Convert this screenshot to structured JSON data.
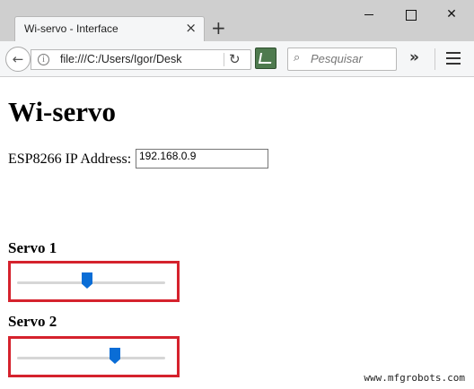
{
  "browser": {
    "tab_title": "Wi-servo - Interface",
    "tab_close_glyph": "×",
    "new_tab_glyph": "+",
    "url": "file:///C:/Users/Igor/Desk",
    "search_placeholder": "Pesquisar",
    "overflow_glyph": "»",
    "back_glyph": "←",
    "reload_glyph": "↻",
    "search_glyph": "⌕",
    "close_glyph": "✕"
  },
  "page": {
    "title": "Wi-servo",
    "ip_label": "ESP8266 IP Address:",
    "ip_value": "192.168.0.9",
    "servos": [
      {
        "heading": "Servo 1",
        "value_fraction": 0.47
      },
      {
        "heading": "Servo 2",
        "value_fraction": 0.67
      }
    ]
  },
  "watermark": "www.mfgrobots.com",
  "colors": {
    "highlight_border": "#d5222d",
    "slider_thumb": "#0a6dd6"
  }
}
